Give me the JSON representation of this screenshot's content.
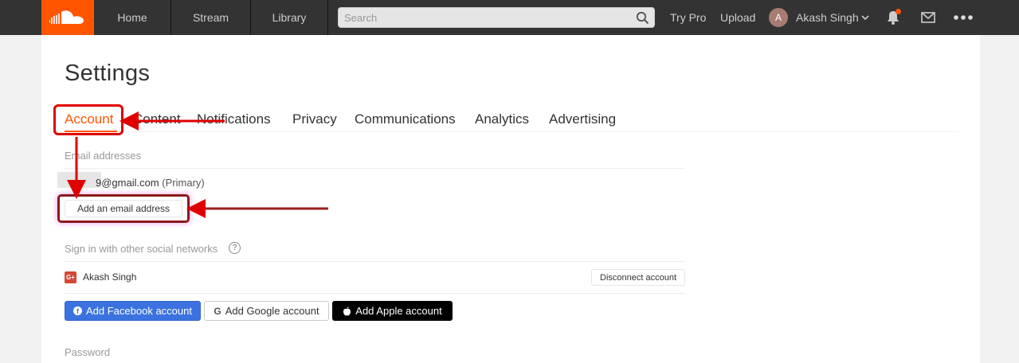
{
  "topbar": {
    "nav_home": "Home",
    "nav_stream": "Stream",
    "nav_library": "Library",
    "search_placeholder": "Search",
    "try_pro": "Try Pro",
    "upload": "Upload",
    "avatar_letter": "A",
    "user_name": "Akash Singh",
    "icons": [
      "soundcloud-logo",
      "search-icon",
      "chevron-down-icon",
      "bell-icon",
      "mail-icon",
      "more-icon"
    ],
    "brand_color": "#ff5500"
  },
  "page": {
    "title": "Settings",
    "tabs": [
      {
        "label": "Account",
        "active": true
      },
      {
        "label": "Content"
      },
      {
        "label": "Notifications"
      },
      {
        "label": "Privacy"
      },
      {
        "label": "Communications"
      },
      {
        "label": "Analytics"
      },
      {
        "label": "Advertising"
      }
    ]
  },
  "email": {
    "section_label": "Email addresses",
    "address": "9@gmail.com",
    "primary_tag": "(Primary)",
    "add_button": "Add an email address"
  },
  "social": {
    "section_label": "Sign in with other social networks",
    "help_glyph": "?",
    "connected_network_badge": "G+",
    "connected_name": "Akash Singh",
    "disconnect_button": "Disconnect account",
    "add_facebook": "Add Facebook account",
    "add_google": "Add Google account",
    "add_apple": "Add Apple account",
    "facebook_color": "#3b72e0"
  },
  "password": {
    "section_label": "Password"
  },
  "annotations": {
    "highlight_color": "#e00000"
  }
}
